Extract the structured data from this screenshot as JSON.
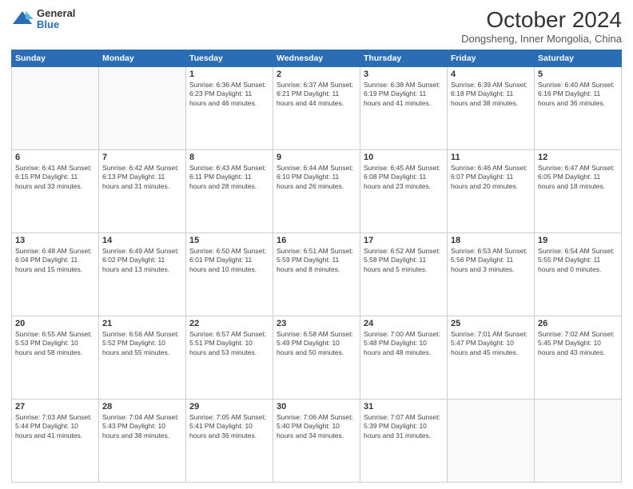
{
  "logo": {
    "general": "General",
    "blue": "Blue"
  },
  "title": "October 2024",
  "subtitle": "Dongsheng, Inner Mongolia, China",
  "days_of_week": [
    "Sunday",
    "Monday",
    "Tuesday",
    "Wednesday",
    "Thursday",
    "Friday",
    "Saturday"
  ],
  "weeks": [
    [
      {
        "day": "",
        "info": "",
        "empty": true
      },
      {
        "day": "",
        "info": "",
        "empty": true
      },
      {
        "day": "1",
        "info": "Sunrise: 6:36 AM\nSunset: 6:23 PM\nDaylight: 11 hours and 46 minutes."
      },
      {
        "day": "2",
        "info": "Sunrise: 6:37 AM\nSunset: 6:21 PM\nDaylight: 11 hours and 44 minutes."
      },
      {
        "day": "3",
        "info": "Sunrise: 6:38 AM\nSunset: 6:19 PM\nDaylight: 11 hours and 41 minutes."
      },
      {
        "day": "4",
        "info": "Sunrise: 6:39 AM\nSunset: 6:18 PM\nDaylight: 11 hours and 38 minutes."
      },
      {
        "day": "5",
        "info": "Sunrise: 6:40 AM\nSunset: 6:16 PM\nDaylight: 11 hours and 36 minutes."
      }
    ],
    [
      {
        "day": "6",
        "info": "Sunrise: 6:41 AM\nSunset: 6:15 PM\nDaylight: 11 hours and 33 minutes."
      },
      {
        "day": "7",
        "info": "Sunrise: 6:42 AM\nSunset: 6:13 PM\nDaylight: 11 hours and 31 minutes."
      },
      {
        "day": "8",
        "info": "Sunrise: 6:43 AM\nSunset: 6:11 PM\nDaylight: 11 hours and 28 minutes."
      },
      {
        "day": "9",
        "info": "Sunrise: 6:44 AM\nSunset: 6:10 PM\nDaylight: 11 hours and 26 minutes."
      },
      {
        "day": "10",
        "info": "Sunrise: 6:45 AM\nSunset: 6:08 PM\nDaylight: 11 hours and 23 minutes."
      },
      {
        "day": "11",
        "info": "Sunrise: 6:46 AM\nSunset: 6:07 PM\nDaylight: 11 hours and 20 minutes."
      },
      {
        "day": "12",
        "info": "Sunrise: 6:47 AM\nSunset: 6:05 PM\nDaylight: 11 hours and 18 minutes."
      }
    ],
    [
      {
        "day": "13",
        "info": "Sunrise: 6:48 AM\nSunset: 6:04 PM\nDaylight: 11 hours and 15 minutes."
      },
      {
        "day": "14",
        "info": "Sunrise: 6:49 AM\nSunset: 6:02 PM\nDaylight: 11 hours and 13 minutes."
      },
      {
        "day": "15",
        "info": "Sunrise: 6:50 AM\nSunset: 6:01 PM\nDaylight: 11 hours and 10 minutes."
      },
      {
        "day": "16",
        "info": "Sunrise: 6:51 AM\nSunset: 5:59 PM\nDaylight: 11 hours and 8 minutes."
      },
      {
        "day": "17",
        "info": "Sunrise: 6:52 AM\nSunset: 5:58 PM\nDaylight: 11 hours and 5 minutes."
      },
      {
        "day": "18",
        "info": "Sunrise: 6:53 AM\nSunset: 5:56 PM\nDaylight: 11 hours and 3 minutes."
      },
      {
        "day": "19",
        "info": "Sunrise: 6:54 AM\nSunset: 5:55 PM\nDaylight: 11 hours and 0 minutes."
      }
    ],
    [
      {
        "day": "20",
        "info": "Sunrise: 6:55 AM\nSunset: 5:53 PM\nDaylight: 10 hours and 58 minutes."
      },
      {
        "day": "21",
        "info": "Sunrise: 6:56 AM\nSunset: 5:52 PM\nDaylight: 10 hours and 55 minutes."
      },
      {
        "day": "22",
        "info": "Sunrise: 6:57 AM\nSunset: 5:51 PM\nDaylight: 10 hours and 53 minutes."
      },
      {
        "day": "23",
        "info": "Sunrise: 6:58 AM\nSunset: 5:49 PM\nDaylight: 10 hours and 50 minutes."
      },
      {
        "day": "24",
        "info": "Sunrise: 7:00 AM\nSunset: 5:48 PM\nDaylight: 10 hours and 48 minutes."
      },
      {
        "day": "25",
        "info": "Sunrise: 7:01 AM\nSunset: 5:47 PM\nDaylight: 10 hours and 45 minutes."
      },
      {
        "day": "26",
        "info": "Sunrise: 7:02 AM\nSunset: 5:45 PM\nDaylight: 10 hours and 43 minutes."
      }
    ],
    [
      {
        "day": "27",
        "info": "Sunrise: 7:03 AM\nSunset: 5:44 PM\nDaylight: 10 hours and 41 minutes."
      },
      {
        "day": "28",
        "info": "Sunrise: 7:04 AM\nSunset: 5:43 PM\nDaylight: 10 hours and 38 minutes."
      },
      {
        "day": "29",
        "info": "Sunrise: 7:05 AM\nSunset: 5:41 PM\nDaylight: 10 hours and 36 minutes."
      },
      {
        "day": "30",
        "info": "Sunrise: 7:06 AM\nSunset: 5:40 PM\nDaylight: 10 hours and 34 minutes."
      },
      {
        "day": "31",
        "info": "Sunrise: 7:07 AM\nSunset: 5:39 PM\nDaylight: 10 hours and 31 minutes."
      },
      {
        "day": "",
        "info": "",
        "empty": true
      },
      {
        "day": "",
        "info": "",
        "empty": true
      }
    ]
  ]
}
